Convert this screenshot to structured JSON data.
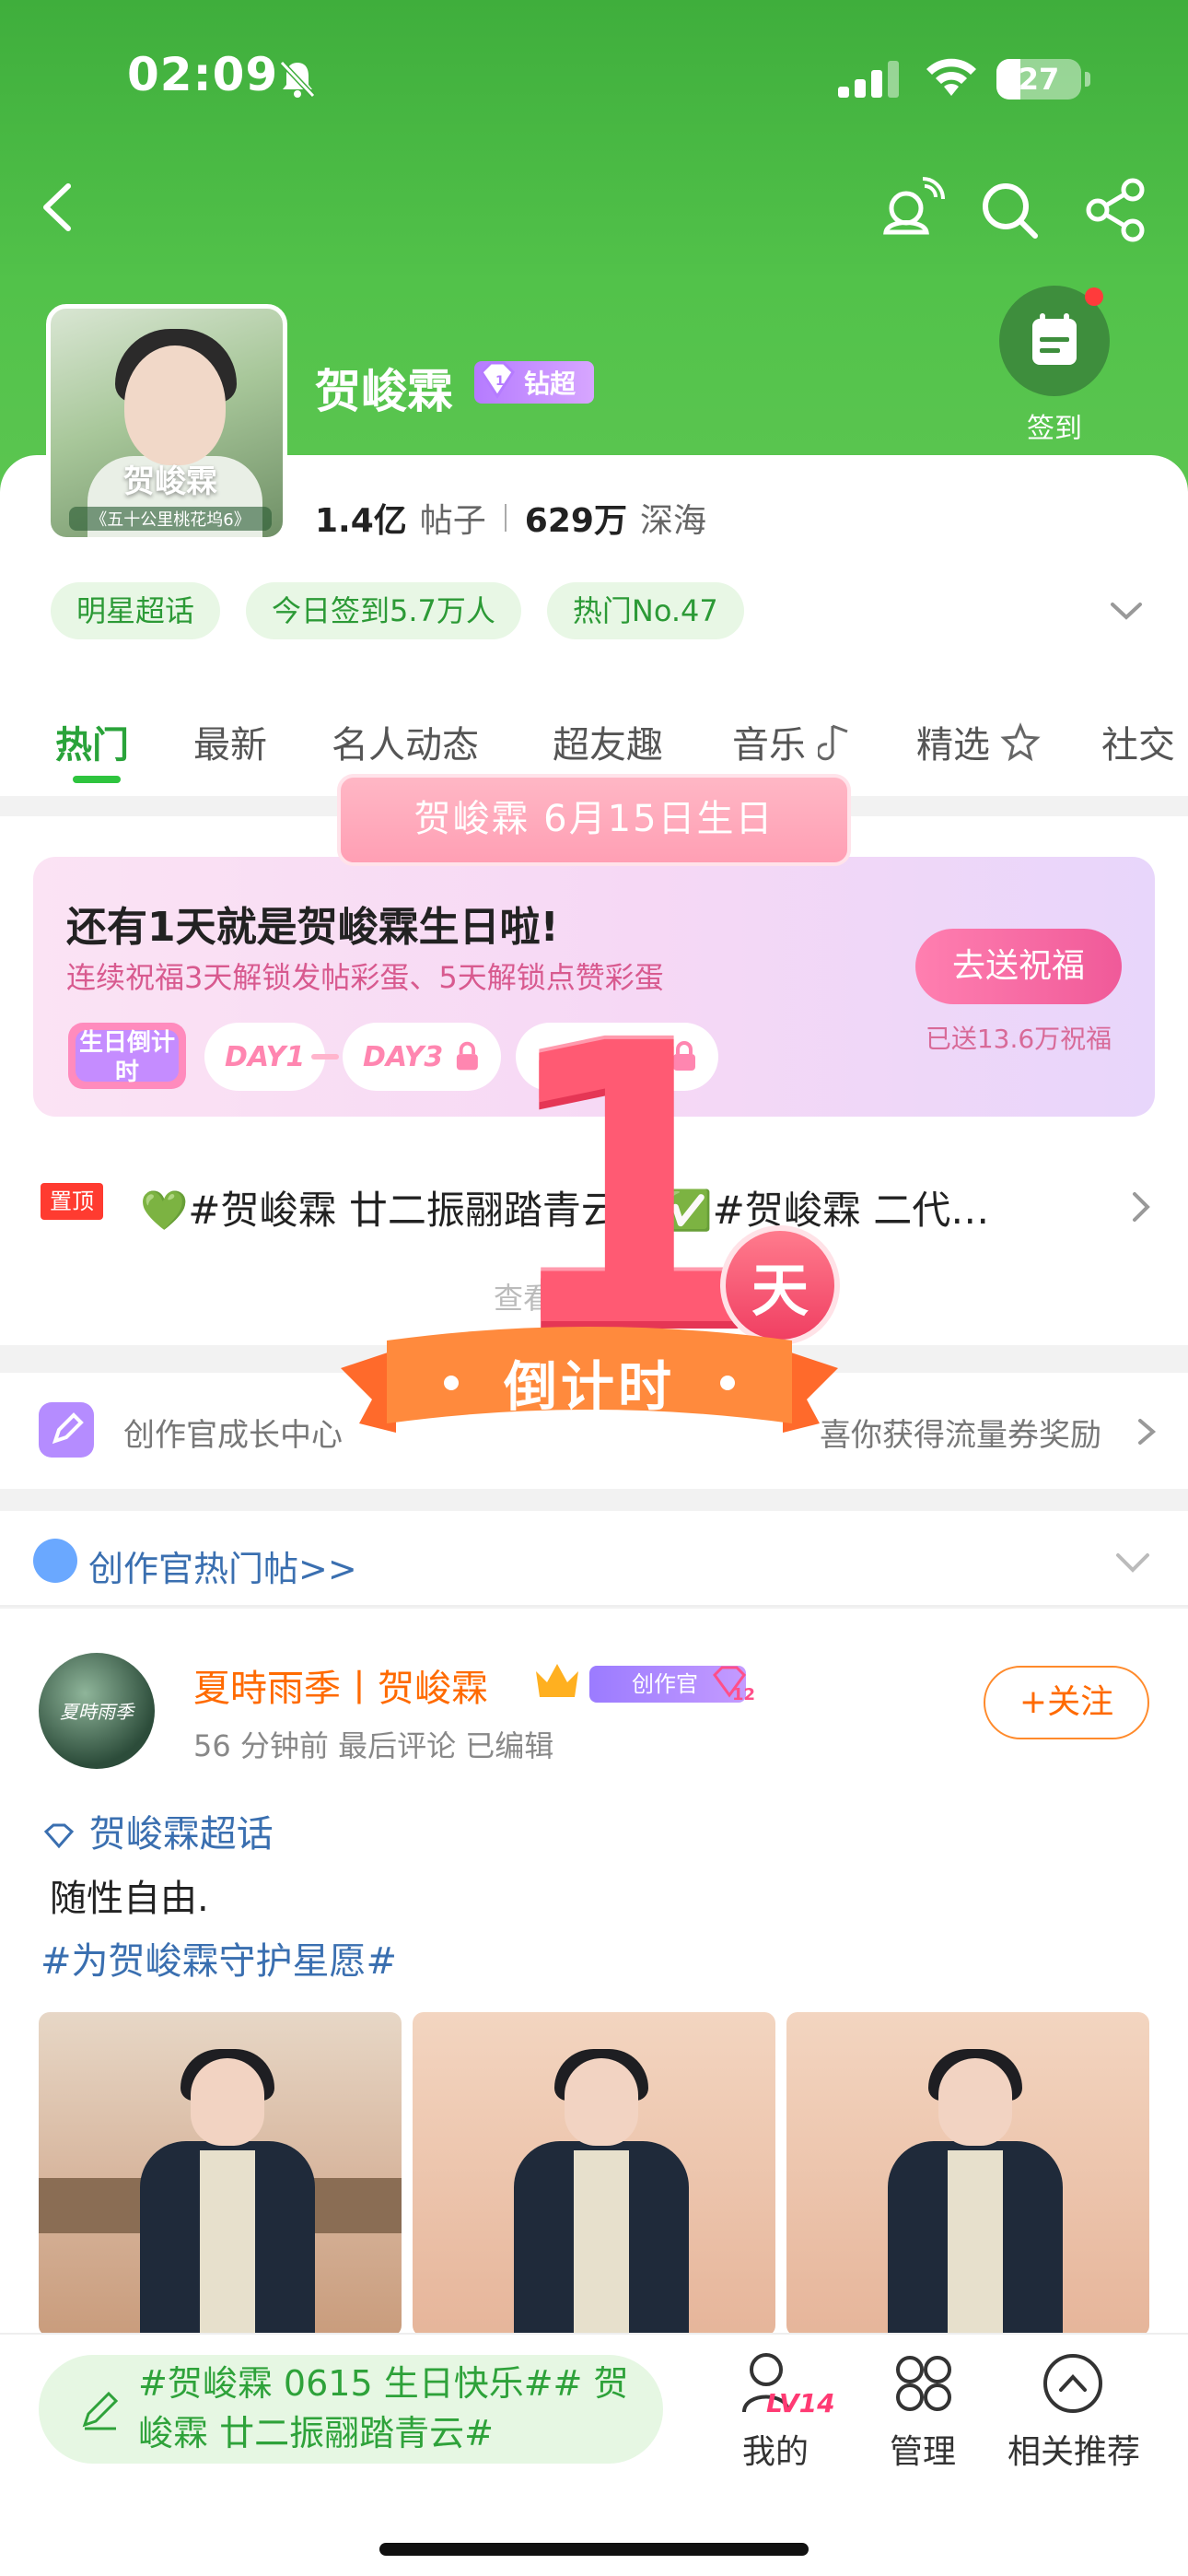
{
  "status_bar": {
    "time": "02:09",
    "battery": "27"
  },
  "header": {
    "signin_label": "签到"
  },
  "profile": {
    "cover_text": "贺峻霖",
    "cover_sub": "《五十公里桃花坞6》",
    "name": "贺峻霖",
    "badge": "钻超",
    "posts_count": "1.4亿",
    "posts_label": "帖子",
    "fans_count": "629万",
    "fans_label": "深海"
  },
  "chips": [
    "明星超话",
    "今日签到5.7万人",
    "热门No.47"
  ],
  "tabs": [
    "热门",
    "最新",
    "名人动态",
    "超友趣",
    "音乐",
    "精选",
    "社交"
  ],
  "birthday": {
    "pill": "贺峻霖 6月15日生日",
    "title": "还有1天就是贺峻霖生日啦!",
    "subtitle": "连续祝福3天解锁发帖彩蛋、5天解锁点赞彩蛋",
    "button": "去送祝福",
    "sent": "已送13.6万祝福",
    "badge_text": "生日倒计时",
    "day1": "DAY1",
    "day3": "DAY3",
    "countdown_number": "1",
    "countdown_unit": "天",
    "countdown_label": "倒计时"
  },
  "pinned": {
    "tag": "置顶",
    "text": "💚#贺峻霖 廿二振翮踏青云# ✅#贺峻霖 二代…",
    "sub": "查看更多活动"
  },
  "creator": {
    "left": "创作官成长中心",
    "right": "喜你获得流量券奖励"
  },
  "hot": {
    "title": "创作官热门帖>>"
  },
  "post": {
    "avatar_text": "夏時雨季",
    "author": "夏時雨季丨贺峻霖",
    "creator_badge": "创作官",
    "level": "12",
    "meta": "56 分钟前 最后评论    已编辑",
    "follow": "+关注",
    "topic": "贺峻霖超话",
    "body": "随性自由.",
    "hashtag": "#为贺峻霖守护星愿#"
  },
  "bottom": {
    "compose_text": "#贺峻霖 0615 生日快乐## 贺峻霖 廿二振翮踏青云#",
    "mine": "我的",
    "mine_level": "LV14",
    "manage": "管理",
    "related": "相关推荐"
  },
  "colors": {
    "brand_green": "#52c24a",
    "accent_pink": "#ff5a73",
    "link_blue": "#3a6fb0",
    "orange": "#ff6a00"
  }
}
